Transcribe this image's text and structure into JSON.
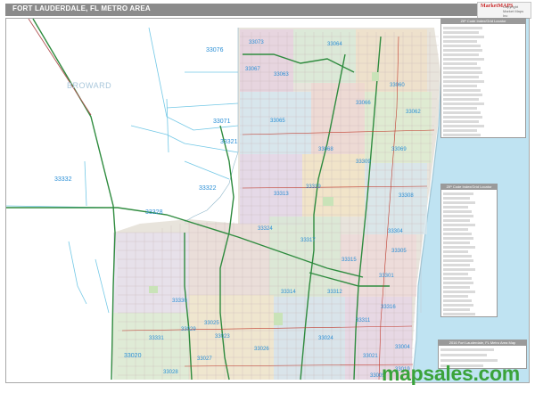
{
  "map": {
    "title": "FORT LAUDERDALE, FL METRO AREA",
    "county_label": "BROWARD",
    "website": "mapsales.com",
    "brand_mark": "MarketMAPS",
    "brand_text": "Copyright Market Maps Inc",
    "colors": {
      "ocean": "#bfe3f2",
      "land": "#ffffff",
      "highway": "#2e8b3e",
      "boundary": "#73c8e6",
      "website": "#3aa33a",
      "title_bar": "#8b8b8b"
    },
    "zip_labels": [
      "33076",
      "33071",
      "33321",
      "33332",
      "33322",
      "33328",
      "33324",
      "33314",
      "33312",
      "33330",
      "33331",
      "33020",
      "33029",
      "33027",
      "33025",
      "33023",
      "33311",
      "33301",
      "33304",
      "33305",
      "33308",
      "33062",
      "33060",
      "33063",
      "33064",
      "33065",
      "33067",
      "33073",
      "33066",
      "33068",
      "33069",
      "33309",
      "33319",
      "33313",
      "33317",
      "33315",
      "33316",
      "33004",
      "33019",
      "33021",
      "33024",
      "33026",
      "33028",
      "33009"
    ],
    "index_panel": {
      "title": "ZIP Code Index/Grid Locator"
    },
    "grid_panel": {
      "title": "ZIP Code Index/Grid Locator"
    },
    "legend_panel": {
      "title": "2016 Fort Lauderdale, FL Metro Area Map"
    }
  }
}
